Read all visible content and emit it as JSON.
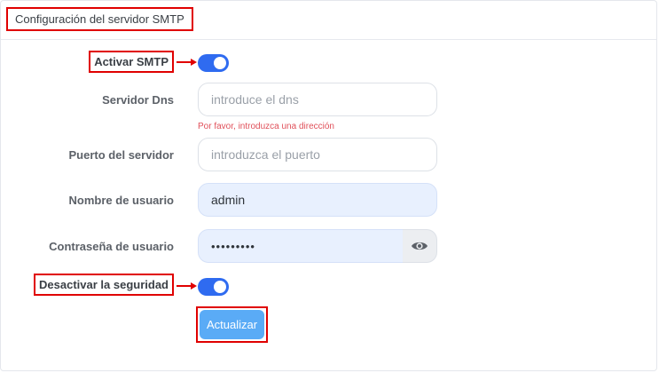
{
  "header": {
    "title": "Configuración del servidor SMTP"
  },
  "form": {
    "activate_smtp": {
      "label": "Activar SMTP",
      "enabled": true
    },
    "dns_server": {
      "label": "Servidor Dns",
      "placeholder": "introduce el dns",
      "value": "",
      "error": "Por favor, introduzca una dirección"
    },
    "server_port": {
      "label": "Puerto del servidor",
      "placeholder": "introduzca el puerto",
      "value": ""
    },
    "username": {
      "label": "Nombre de usuario",
      "value": "admin"
    },
    "password": {
      "label": "Contraseña de usuario",
      "value": "•••••••••",
      "toggle_icon": "eye-icon"
    },
    "disable_security": {
      "label": "Desactivar la seguridad",
      "enabled": true
    },
    "submit_label": "Actualizar"
  },
  "colors": {
    "accent": "#2f6bf0",
    "button": "#5aabf6",
    "highlight": "#e00000",
    "error": "#e0505a"
  }
}
